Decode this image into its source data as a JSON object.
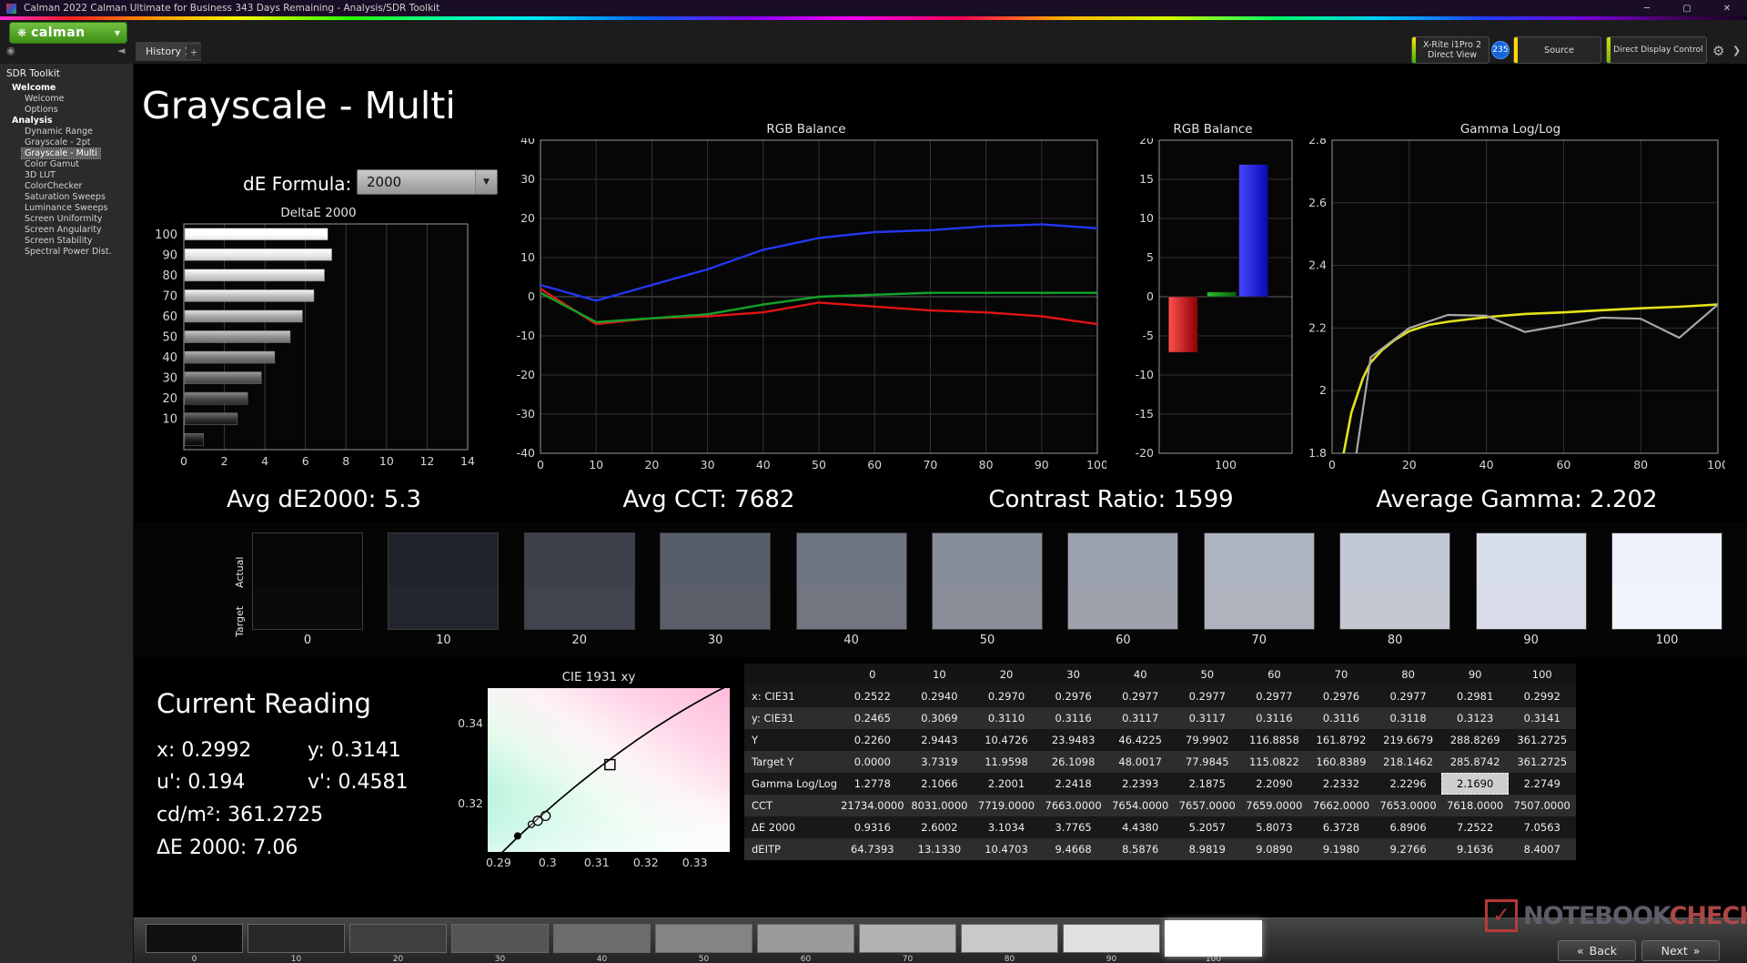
{
  "window": {
    "title": "Calman 2022 Calman Ultimate for Business 343 Days Remaining  - Analysis/SDR Toolkit",
    "minimize_glyph": "─",
    "maximize_glyph": "▢",
    "close_glyph": "✕"
  },
  "icons": {
    "calman_logo": "❋",
    "caret_down": "▼",
    "sidebar_collapse": "◄",
    "workflow_nav": "◉",
    "gear": "⚙",
    "expand": "❯",
    "back_chevron": "«",
    "next_chevron": "»"
  },
  "toolbar": {
    "logo_text": "calman",
    "tab_label": "History 1",
    "tab_add": "+",
    "meter_line1": "X-Rite i1Pro 2",
    "meter_line2": "Direct View",
    "meter_badge": "235",
    "source_label": "Source",
    "display_label": "Direct Display Control"
  },
  "sidebar": {
    "header": "SDR Toolkit",
    "tree": [
      {
        "label": "Welcome",
        "level": 0
      },
      {
        "label": "Welcome",
        "level": 1
      },
      {
        "label": "Options",
        "level": 1
      },
      {
        "label": "Analysis",
        "level": 0
      },
      {
        "label": "Dynamic Range",
        "level": 1
      },
      {
        "label": "Grayscale - 2pt",
        "level": 1
      },
      {
        "label": "Grayscale - Multi",
        "level": 1,
        "selected": true
      },
      {
        "label": "Color Gamut",
        "level": 1
      },
      {
        "label": "3D LUT",
        "level": 1
      },
      {
        "label": "ColorChecker",
        "level": 1
      },
      {
        "label": "Saturation Sweeps",
        "level": 1
      },
      {
        "label": "Luminance Sweeps",
        "level": 1
      },
      {
        "label": "Screen Uniformity",
        "level": 1
      },
      {
        "label": "Screen Angularity",
        "level": 1
      },
      {
        "label": "Screen Stability",
        "level": 1
      },
      {
        "label": "Spectral Power Dist.",
        "level": 1
      }
    ]
  },
  "page": {
    "title": "Grayscale - Multi",
    "de_formula_label": "dE Formula:",
    "de_formula_value": "2000"
  },
  "stats": {
    "avg_de2000": "Avg dE2000: 5.3",
    "avg_cct": "Avg CCT: 7682",
    "contrast_ratio": "Contrast Ratio: 1599",
    "average_gamma": "Average Gamma: 2.202"
  },
  "chart_data": [
    {
      "id": "deltae",
      "type": "bar",
      "title": "DeltaE 2000",
      "orientation": "horizontal",
      "categories": [
        100,
        90,
        80,
        70,
        60,
        50,
        40,
        30,
        20,
        10,
        0
      ],
      "values": [
        7.0563,
        7.2522,
        6.8906,
        6.3728,
        5.8073,
        5.2057,
        4.438,
        3.7765,
        3.1034,
        2.6002,
        0.9316
      ],
      "xlim": [
        0,
        14
      ],
      "xticks": [
        0,
        2,
        4,
        6,
        8,
        10,
        12,
        14
      ]
    },
    {
      "id": "rgb_balance_line",
      "type": "line",
      "title": "RGB Balance",
      "x": [
        0,
        10,
        20,
        30,
        40,
        50,
        60,
        70,
        80,
        90,
        100
      ],
      "xlim": [
        0,
        100
      ],
      "xticks": [
        0,
        10,
        20,
        30,
        40,
        50,
        60,
        70,
        80,
        90,
        100
      ],
      "ylim": [
        -40,
        40
      ],
      "yticks": [
        40,
        30,
        20,
        10,
        0,
        -10,
        -20,
        -30,
        -40
      ],
      "series": [
        {
          "name": "Red",
          "color": "#e01414",
          "values": [
            2,
            -7,
            -5.5,
            -5,
            -4,
            -1.5,
            -2.5,
            -3.5,
            -4,
            -5,
            -7
          ]
        },
        {
          "name": "Green",
          "color": "#14a32a",
          "values": [
            1,
            -6.5,
            -5.5,
            -4.5,
            -2,
            0,
            0.5,
            1,
            1,
            1,
            1
          ]
        },
        {
          "name": "Blue",
          "color": "#2337f0",
          "values": [
            3,
            -1,
            3,
            7,
            12,
            15,
            16.5,
            17,
            18,
            18.5,
            17.5
          ]
        }
      ]
    },
    {
      "id": "rgb_balance_bar",
      "type": "bar",
      "title": "RGB Balance",
      "categories": [
        "Red",
        "Green",
        "Blue"
      ],
      "values": [
        -7.1,
        0.6,
        16.9
      ],
      "fills": [
        [
          "#ff5050",
          "#8c0000"
        ],
        [
          "#30c030",
          "#076007"
        ],
        [
          "#4646ff",
          "#0909b4"
        ]
      ],
      "ylim": [
        -20,
        20
      ],
      "yticks": [
        20,
        15,
        10,
        5,
        0,
        -5,
        -10,
        -15,
        -20
      ],
      "x_label": "100"
    },
    {
      "id": "gamma",
      "type": "line",
      "title": "Gamma Log/Log",
      "xlim": [
        0,
        100
      ],
      "xticks": [
        0,
        20,
        40,
        60,
        80,
        100
      ],
      "ylim": [
        1.8,
        2.8
      ],
      "yticks": [
        2.8,
        2.6,
        2.4,
        2.2,
        2,
        1.8
      ],
      "series": [
        {
          "name": "Target",
          "color": "#e3e31c",
          "width": 2.6,
          "x": [
            3,
            5,
            8,
            10,
            13,
            16,
            20,
            25,
            30,
            40,
            50,
            60,
            70,
            80,
            90,
            100
          ],
          "values": [
            1.8,
            1.93,
            2.04,
            2.09,
            2.13,
            2.16,
            2.19,
            2.21,
            2.22,
            2.235,
            2.245,
            2.25,
            2.257,
            2.263,
            2.268,
            2.275
          ]
        },
        {
          "name": "Measured",
          "color": "#a8a8a8",
          "width": 2.2,
          "x": [
            0,
            10,
            20,
            30,
            40,
            50,
            60,
            70,
            80,
            90,
            100
          ],
          "values": [
            1.2778,
            2.1066,
            2.2001,
            2.2418,
            2.2393,
            2.1875,
            2.209,
            2.2332,
            2.2296,
            2.169,
            2.2749
          ]
        }
      ]
    },
    {
      "id": "cie",
      "type": "scatter",
      "title": "CIE 1931 xy",
      "xlim": [
        0.2878,
        0.3371
      ],
      "ylim": [
        0.308,
        0.3489
      ],
      "xticks": [
        "0.29",
        "0.3",
        "0.31",
        "0.32",
        "0.33"
      ],
      "yticks": [
        "0.34",
        "0.32"
      ],
      "target_square": {
        "x": 0.3127,
        "y": 0.3298
      },
      "measured_circles": [
        {
          "x": 0.2996,
          "y": 0.317,
          "r": 5
        },
        {
          "x": 0.298,
          "y": 0.3158,
          "r": 5
        },
        {
          "x": 0.2967,
          "y": 0.3149,
          "r": 3.5
        }
      ],
      "locus_dot": {
        "x": 0.2939,
        "y": 0.312
      },
      "locus": [
        [
          0.29,
          0.307
        ],
        [
          0.294,
          0.3118
        ],
        [
          0.298,
          0.3163
        ],
        [
          0.302,
          0.3206
        ],
        [
          0.306,
          0.3247
        ],
        [
          0.31,
          0.3286
        ],
        [
          0.314,
          0.3323
        ],
        [
          0.318,
          0.3358
        ],
        [
          0.322,
          0.3391
        ],
        [
          0.326,
          0.3422
        ],
        [
          0.33,
          0.3451
        ],
        [
          0.334,
          0.3478
        ],
        [
          0.337,
          0.3497
        ]
      ]
    }
  ],
  "grayscale_swatches": {
    "row_labels": [
      "Actual",
      "Target"
    ],
    "levels": [
      "0",
      "10",
      "20",
      "30",
      "40",
      "50",
      "60",
      "70",
      "80",
      "90",
      "100"
    ],
    "actual_colors": [
      "#060608",
      "#1f232c",
      "#3c414c",
      "#575d69",
      "#6e7582",
      "#878d9a",
      "#9aa0ad",
      "#aeb4c1",
      "#c2c8d5",
      "#d7dde9",
      "#eef2fc"
    ],
    "target_colors": [
      "#0a0a0c",
      "#23262f",
      "#40444e",
      "#5a5f6a",
      "#717680",
      "#898e98",
      "#9ca1ab",
      "#b0b4be",
      "#c4c8d2",
      "#d9dce8",
      "#f1f4fb"
    ]
  },
  "current_reading": {
    "title": "Current Reading",
    "x": "x: 0.2992",
    "y": "y: 0.3141",
    "u": "u': 0.194",
    "v": "v': 0.4581",
    "luminance": "cd/m²: 361.2725",
    "de2000": "ΔE 2000: 7.06"
  },
  "table": {
    "columns": [
      "",
      "0",
      "10",
      "20",
      "30",
      "40",
      "50",
      "60",
      "70",
      "80",
      "90",
      "100"
    ],
    "rows": [
      {
        "label": "x: CIE31",
        "values": [
          "0.2522",
          "0.2940",
          "0.2970",
          "0.2976",
          "0.2977",
          "0.2977",
          "0.2977",
          "0.2976",
          "0.2977",
          "0.2981",
          "0.2992"
        ]
      },
      {
        "label": "y: CIE31",
        "values": [
          "0.2465",
          "0.3069",
          "0.3110",
          "0.3116",
          "0.3117",
          "0.3117",
          "0.3116",
          "0.3116",
          "0.3118",
          "0.3123",
          "0.3141"
        ]
      },
      {
        "label": "Y",
        "values": [
          "0.2260",
          "2.9443",
          "10.4726",
          "23.9483",
          "46.4225",
          "79.9902",
          "116.8858",
          "161.8792",
          "219.6679",
          "288.8269",
          "361.2725"
        ]
      },
      {
        "label": "Target Y",
        "values": [
          "0.0000",
          "3.7319",
          "11.9598",
          "26.1098",
          "48.0017",
          "77.9845",
          "115.0822",
          "160.8389",
          "218.1462",
          "285.8742",
          "361.2725"
        ]
      },
      {
        "label": "Gamma Log/Log",
        "values": [
          "1.2778",
          "2.1066",
          "2.2001",
          "2.2418",
          "2.2393",
          "2.1875",
          "2.2090",
          "2.2332",
          "2.2296",
          "2.1690",
          "2.2749"
        ]
      },
      {
        "label": "CCT",
        "values": [
          "21734.0000",
          "8031.0000",
          "7719.0000",
          "7663.0000",
          "7654.0000",
          "7657.0000",
          "7659.0000",
          "7662.0000",
          "7653.0000",
          "7618.0000",
          "7507.0000"
        ]
      },
      {
        "label": "ΔE 2000",
        "values": [
          "0.9316",
          "2.6002",
          "3.1034",
          "3.7765",
          "4.4380",
          "5.2057",
          "5.8073",
          "6.3728",
          "6.8906",
          "7.2522",
          "7.0563"
        ]
      },
      {
        "label": "dEITP",
        "values": [
          "64.7393",
          "13.1330",
          "10.4703",
          "9.4668",
          "8.5876",
          "8.9819",
          "9.0890",
          "9.1980",
          "9.2766",
          "9.1636",
          "8.4007"
        ]
      }
    ],
    "selected_cell": {
      "row": 4,
      "col": 9
    }
  },
  "pattern_bar": {
    "levels": [
      "0",
      "10",
      "20",
      "30",
      "40",
      "50",
      "60",
      "70",
      "80",
      "90",
      "100"
    ],
    "colors": [
      "#111111",
      "#282828",
      "#3f3f3f",
      "#565656",
      "#6d6d6d",
      "#848484",
      "#9b9b9b",
      "#b2b2b2",
      "#c9c9c9",
      "#e0e0e0",
      "#ffffff"
    ],
    "selected_index": 10,
    "back_label": "Back",
    "next_label": "Next"
  },
  "watermark": {
    "check": "✓",
    "text1": "NOTEBOOK",
    "text2": "CHECK"
  }
}
